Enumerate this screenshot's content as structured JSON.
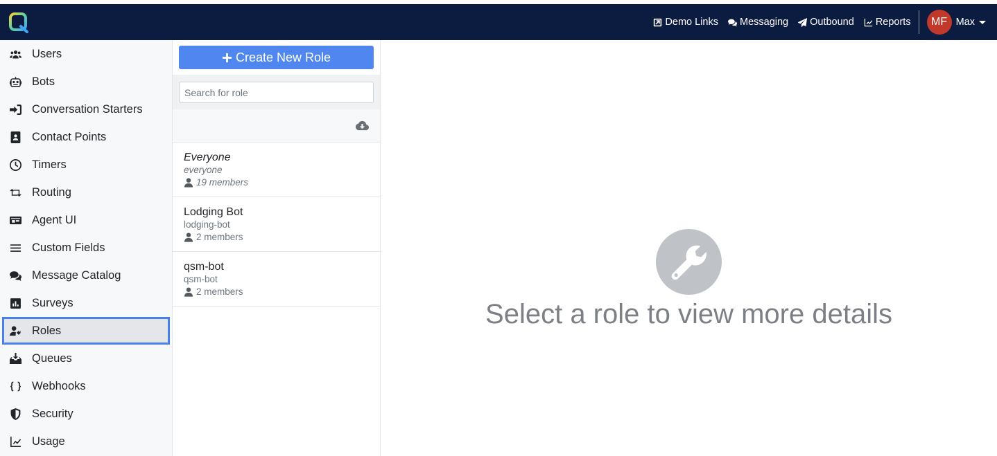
{
  "topbar": {
    "nav": [
      {
        "label": "Demo Links",
        "icon": "external-link-icon"
      },
      {
        "label": "Messaging",
        "icon": "comments-icon"
      },
      {
        "label": "Outbound",
        "icon": "paper-plane-icon"
      },
      {
        "label": "Reports",
        "icon": "line-chart-icon"
      }
    ],
    "user": {
      "initials": "MF",
      "name": "Max"
    }
  },
  "sidebar": {
    "items": [
      {
        "label": "Users",
        "icon": "users-icon"
      },
      {
        "label": "Bots",
        "icon": "robot-icon"
      },
      {
        "label": "Conversation Starters",
        "icon": "sign-in-icon"
      },
      {
        "label": "Contact Points",
        "icon": "address-book-icon"
      },
      {
        "label": "Timers",
        "icon": "clock-icon"
      },
      {
        "label": "Routing",
        "icon": "retweet-icon"
      },
      {
        "label": "Agent UI",
        "icon": "id-card-icon"
      },
      {
        "label": "Custom Fields",
        "icon": "bars-icon"
      },
      {
        "label": "Message Catalog",
        "icon": "comments-icon"
      },
      {
        "label": "Surveys",
        "icon": "poll-icon"
      },
      {
        "label": "Roles",
        "icon": "user-tag-icon",
        "active": true
      },
      {
        "label": "Queues",
        "icon": "inbox-download-icon"
      },
      {
        "label": "Webhooks",
        "icon": "braces-icon"
      },
      {
        "label": "Security",
        "icon": "shield-icon"
      },
      {
        "label": "Usage",
        "icon": "area-chart-icon"
      }
    ]
  },
  "roles_panel": {
    "create_label": "Create New Role",
    "search_placeholder": "Search for role",
    "roles": [
      {
        "name": "Everyone",
        "slug": "everyone",
        "members": "19 members"
      },
      {
        "name": "Lodging Bot",
        "slug": "lodging-bot",
        "members": "2 members"
      },
      {
        "name": "qsm-bot",
        "slug": "qsm-bot",
        "members": "2 members"
      }
    ]
  },
  "main": {
    "empty_message": "Select a role to view more details",
    "icon": "wrench-icon"
  },
  "colors": {
    "topbar": "#0c1c40",
    "accent": "#4f86f0",
    "active_outline": "#4a80ec",
    "avatar": "#c0392b"
  }
}
